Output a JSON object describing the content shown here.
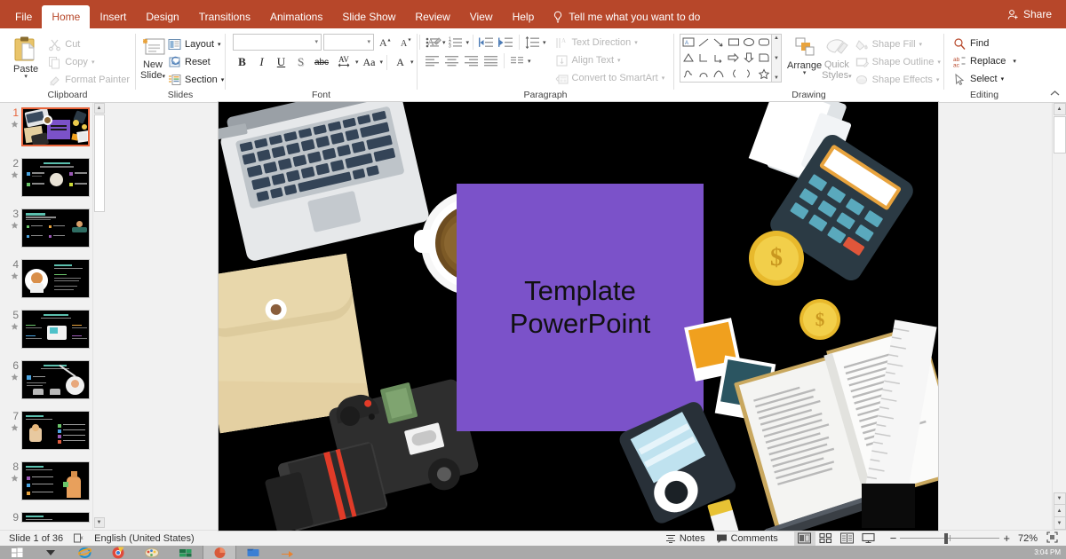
{
  "window": {
    "tabs": [
      {
        "label": "File",
        "id": "file"
      },
      {
        "label": "Home",
        "id": "home",
        "active": true
      },
      {
        "label": "Insert",
        "id": "insert"
      },
      {
        "label": "Design",
        "id": "design"
      },
      {
        "label": "Transitions",
        "id": "transitions"
      },
      {
        "label": "Animations",
        "id": "animations"
      },
      {
        "label": "Slide Show",
        "id": "slide-show"
      },
      {
        "label": "Review",
        "id": "review"
      },
      {
        "label": "View",
        "id": "view"
      },
      {
        "label": "Help",
        "id": "help"
      }
    ],
    "tell_me": "Tell me what you want to do",
    "tell_me_icon": "lightbulb-icon",
    "share_label": "Share",
    "share_icon": "share-person-icon",
    "accent_color": "#B7472A"
  },
  "ribbon": {
    "groups": [
      {
        "name": "Clipboard",
        "label": "Clipboard",
        "paste": {
          "label": "Paste",
          "icon": "clipboard-icon",
          "caret": "▾"
        },
        "items": [
          {
            "label": "Cut",
            "icon": "scissors-icon",
            "disabled": true
          },
          {
            "label": "Copy",
            "icon": "copy-icon",
            "disabled": true,
            "caret": "▾"
          },
          {
            "label": "Format Painter",
            "icon": "format-painter-icon",
            "disabled": true
          }
        ]
      },
      {
        "name": "Slides",
        "label": "Slides",
        "new_slide": {
          "label_line1": "New",
          "label_line2": "Slide",
          "icon": "new-slide-icon",
          "caret": "▾"
        },
        "items": [
          {
            "label": "Layout",
            "icon": "layout-icon",
            "caret": "▾"
          },
          {
            "label": "Reset",
            "icon": "reset-icon"
          },
          {
            "label": "Section",
            "icon": "section-icon",
            "caret": "▾"
          }
        ]
      },
      {
        "name": "Font",
        "label": "Font",
        "font_name": {
          "value": "",
          "placeholder": ""
        },
        "font_size": {
          "value": "",
          "placeholder": ""
        },
        "grow_icon": "grow-font-icon",
        "shrink_icon": "shrink-font-icon",
        "clear_format_icon": "clear-formatting-icon",
        "buttons": [
          {
            "label": "B",
            "name": "bold-button"
          },
          {
            "label": "I",
            "name": "italic-button"
          },
          {
            "label": "U",
            "name": "underline-button"
          },
          {
            "label": "S",
            "name": "shadow-button"
          },
          {
            "label": "abc",
            "name": "strikethrough-button"
          },
          {
            "label": "AV",
            "name": "character-spacing-button",
            "caret": "▾"
          },
          {
            "label": "Aa",
            "name": "change-case-button",
            "caret": "▾"
          },
          {
            "label": "A",
            "name": "font-color-button",
            "caret": "▾"
          }
        ]
      },
      {
        "name": "Paragraph",
        "label": "Paragraph",
        "items": [
          {
            "label": "Text Direction",
            "icon": "text-direction-icon",
            "disabled": true,
            "caret": "▾"
          },
          {
            "label": "Align Text",
            "icon": "align-text-icon",
            "disabled": true,
            "caret": "▾"
          },
          {
            "label": "Convert to SmartArt",
            "icon": "smartart-icon",
            "disabled": true,
            "caret": "▾"
          }
        ]
      },
      {
        "name": "Drawing",
        "label": "Drawing",
        "arrange": {
          "label": "Arrange",
          "icon": "arrange-icon",
          "caret": "▾"
        },
        "quick_styles": {
          "label_line1": "Quick",
          "label_line2": "Styles",
          "icon": "quick-styles-icon",
          "caret": "▾"
        },
        "items": [
          {
            "label": "Shape Fill",
            "icon": "shape-fill-icon",
            "disabled": true,
            "caret": "▾"
          },
          {
            "label": "Shape Outline",
            "icon": "shape-outline-icon",
            "disabled": true,
            "caret": "▾"
          },
          {
            "label": "Shape Effects",
            "icon": "shape-effects-icon",
            "disabled": true,
            "caret": "▾"
          }
        ]
      },
      {
        "name": "Editing",
        "label": "Editing",
        "items": [
          {
            "label": "Find",
            "icon": "search-icon"
          },
          {
            "label": "Replace",
            "icon": "replace-icon",
            "caret": "▾"
          },
          {
            "label": "Select",
            "icon": "select-cursor-icon",
            "caret": "▾"
          }
        ],
        "collapse_icon": "chevron-up-icon"
      }
    ]
  },
  "thumbnails": {
    "star_icon": "animation-star-icon",
    "slides": [
      {
        "number": "1",
        "selected": true,
        "animated": true
      },
      {
        "number": "2",
        "selected": false,
        "animated": true
      },
      {
        "number": "3",
        "selected": false,
        "animated": true
      },
      {
        "number": "4",
        "selected": false,
        "animated": true
      },
      {
        "number": "5",
        "selected": false,
        "animated": true
      },
      {
        "number": "6",
        "selected": false,
        "animated": true
      },
      {
        "number": "7",
        "selected": false,
        "animated": true
      },
      {
        "number": "8",
        "selected": false,
        "animated": true
      },
      {
        "number": "9",
        "selected": false,
        "animated": true
      }
    ]
  },
  "slide": {
    "background_color": "#000000",
    "title_box_color": "#7B52C9",
    "title_line1": "Template",
    "title_line2": "PowerPoint",
    "title_text_color": "#111111",
    "objects": [
      "laptop",
      "coffee-cup",
      "envelope",
      "camera",
      "calculator",
      "receipt",
      "coin-gold-large",
      "coin-gold-small",
      "photo-orange",
      "photo-teal",
      "open-book",
      "ruler",
      "pencil",
      "eraser",
      "camera-film",
      "notebook"
    ]
  },
  "status_bar": {
    "slide_counter": "Slide 1 of 36",
    "language_icon": "spell-check-icon",
    "language": "English (United States)",
    "notes": {
      "label": "Notes",
      "icon": "notes-icon"
    },
    "comments": {
      "label": "Comments",
      "icon": "comment-icon"
    },
    "views": [
      {
        "name": "normal-view",
        "icon": "normal-view-icon",
        "active": true
      },
      {
        "name": "slide-sorter-view",
        "icon": "slide-sorter-icon",
        "active": false
      },
      {
        "name": "reading-view",
        "icon": "reading-view-icon",
        "active": false
      },
      {
        "name": "slide-show-view",
        "icon": "slide-show-icon",
        "active": false
      }
    ],
    "zoom_out_icon": "minus-icon",
    "zoom_in_icon": "plus-icon",
    "zoom_level": "72%",
    "fit_icon": "fit-to-window-icon"
  },
  "taskbar": {
    "start_icon": "windows-start-icon",
    "items": [
      {
        "name": "internet-explorer-icon"
      },
      {
        "name": "chrome-icon"
      },
      {
        "name": "paint-icon"
      },
      {
        "name": "excel-icon"
      },
      {
        "name": "powerpoint-icon",
        "active": true
      },
      {
        "name": "folder-icon"
      }
    ],
    "clock": "3:04 PM"
  }
}
